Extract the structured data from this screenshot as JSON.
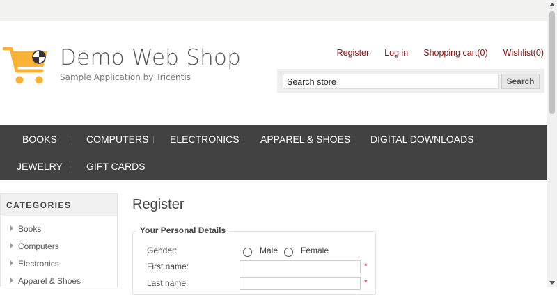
{
  "header": {
    "title": "Demo Web Shop",
    "subtitle": "Sample Application by Tricentis",
    "links": [
      "Register",
      "Log in",
      "Shopping cart(0)",
      "Wishlist(0)"
    ],
    "logo_icon": "shopping-cart-logo-icon",
    "brand_color": "#f9b233"
  },
  "search": {
    "placeholder": "Search store",
    "button_label": "Search"
  },
  "nav": {
    "row1": [
      "BOOKS",
      "COMPUTERS",
      "ELECTRONICS",
      "APPAREL & SHOES",
      "DIGITAL DOWNLOADS"
    ],
    "row2": [
      "JEWELRY",
      "GIFT CARDS"
    ]
  },
  "sidebar": {
    "title": "CATEGORIES",
    "items": [
      "Books",
      "Computers",
      "Electronics",
      "Apparel & Shoes"
    ]
  },
  "main": {
    "title": "Register",
    "section_title": "Your Personal Details",
    "gender_label": "Gender:",
    "gender_options": [
      "Male",
      "Female"
    ],
    "first_name_label": "First name:",
    "last_name_label": "Last name:",
    "required_mark": "*"
  }
}
